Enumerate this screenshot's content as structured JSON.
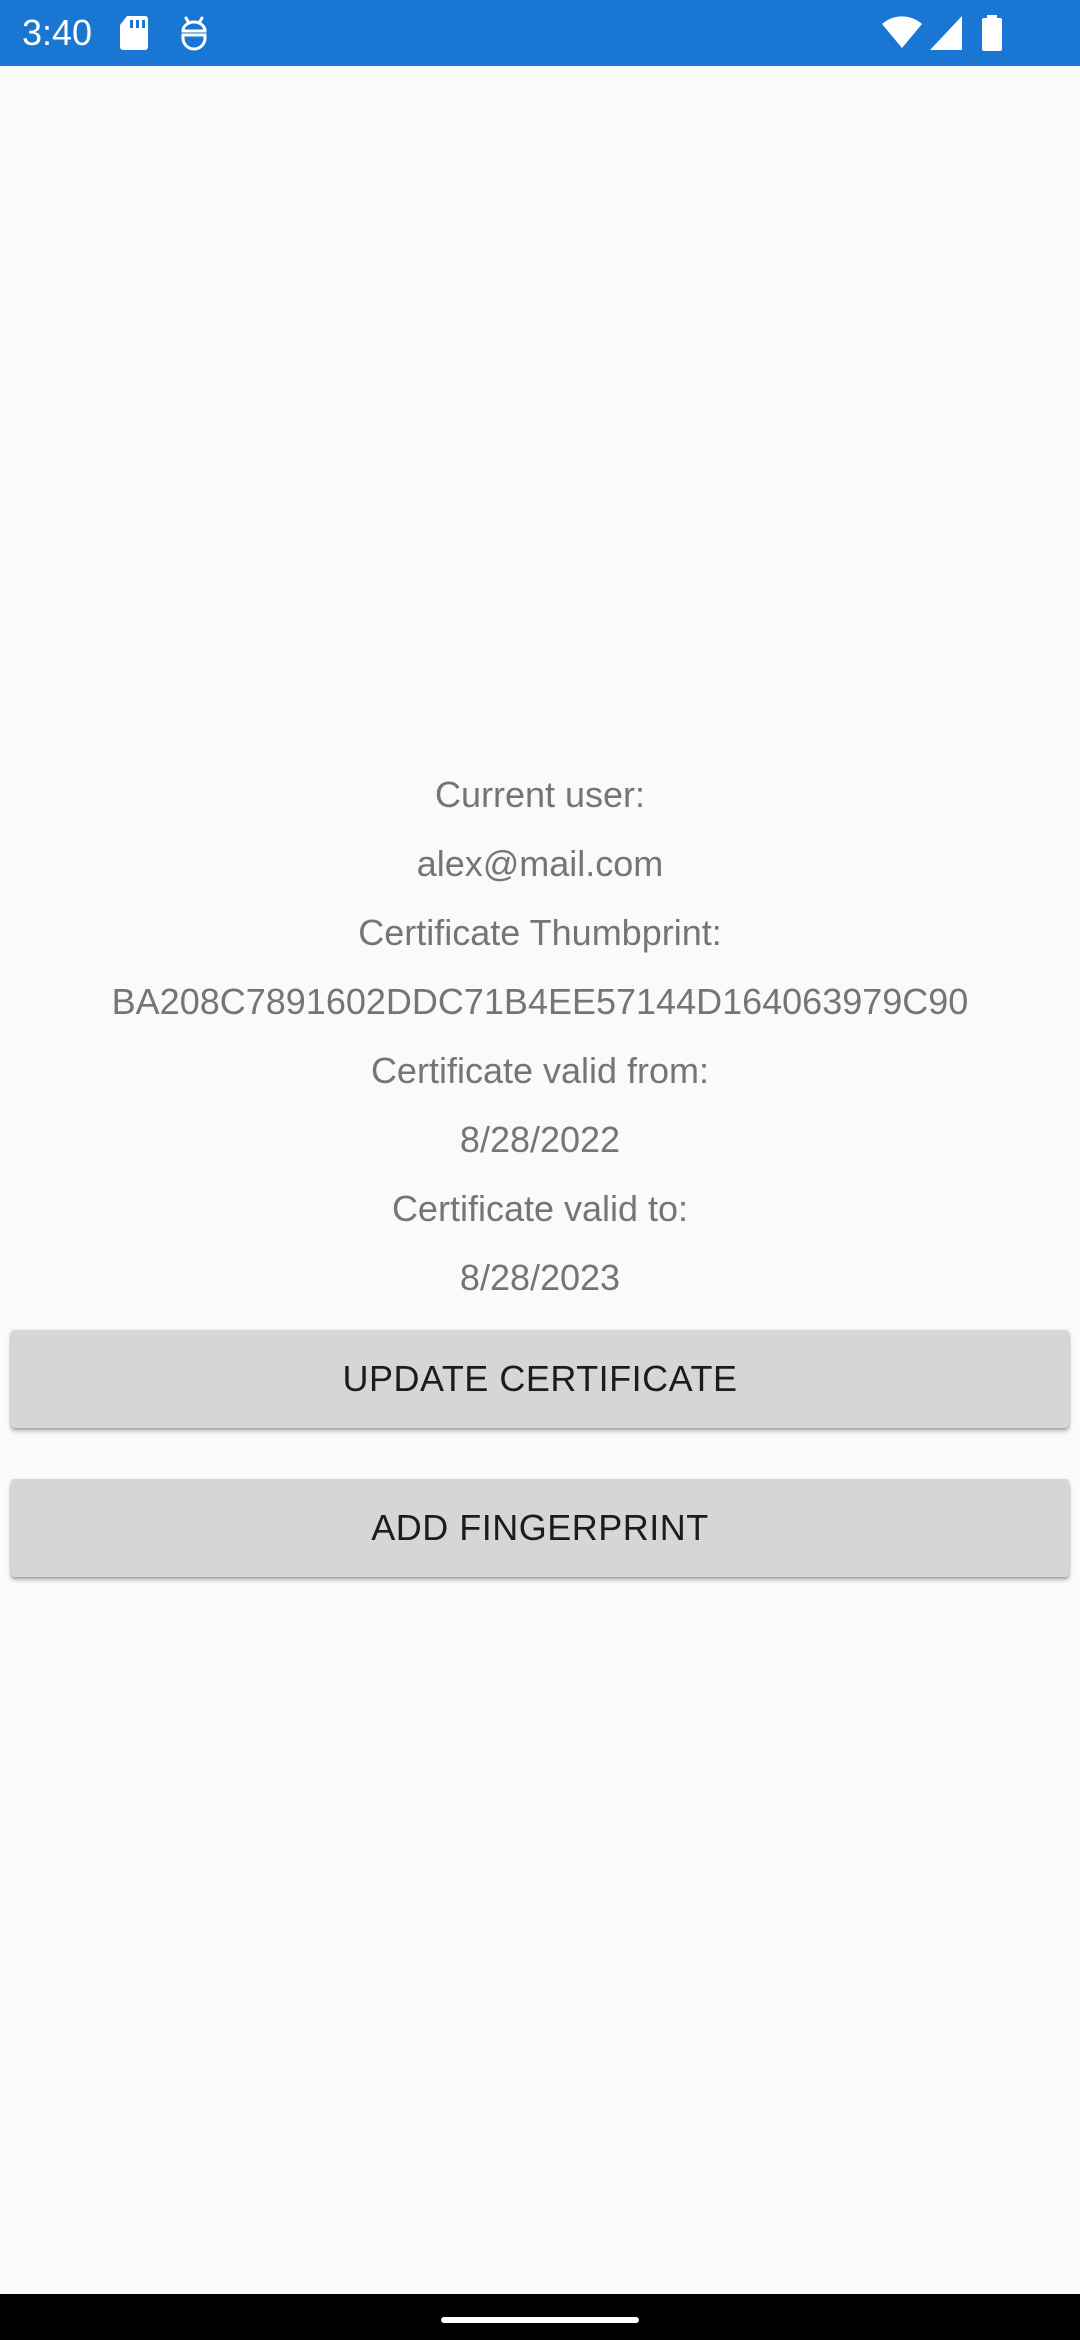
{
  "status_bar": {
    "time": "3:40",
    "background_color": "#1976d2",
    "left_icons": [
      "sd-card-icon",
      "debug-icon"
    ],
    "right_icons": [
      "wifi-icon",
      "cell-signal-icon",
      "battery-icon"
    ]
  },
  "info": {
    "current_user_label": "Current user:",
    "current_user_value": "alex@mail.com",
    "thumbprint_label": "Certificate Thumbprint:",
    "thumbprint_value": "BA208C7891602DDC71B4EE57144D164063979C90",
    "valid_from_label": "Certificate valid from:",
    "valid_from_value": "8/28/2022",
    "valid_to_label": "Certificate valid to:",
    "valid_to_value": "8/28/2023"
  },
  "buttons": {
    "update_certificate": "UPDATE CERTIFICATE",
    "add_fingerprint": "ADD FINGERPRINT"
  },
  "colors": {
    "text_secondary": "#757575",
    "button_background": "#d6d6d6",
    "page_background": "#fafafa"
  }
}
